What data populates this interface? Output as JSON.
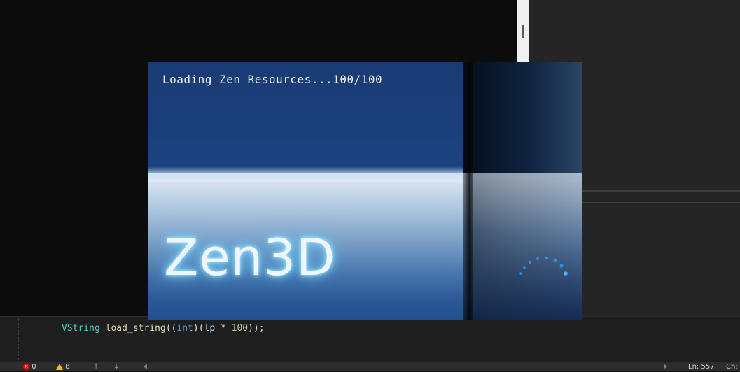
{
  "editor": {
    "code": {
      "type": "VString",
      "func": "load_string",
      "paren_open": "((",
      "keyword": "int",
      "mid": ")(",
      "var": "lp",
      "op": " * ",
      "num": "100",
      "tail": "));"
    }
  },
  "statusbar": {
    "errors": "0",
    "warnings": "8",
    "line": "Ln: 557",
    "char": "Ch:"
  },
  "splash": {
    "loading_text": "Loading Zen Resources...100/100",
    "progress": 1.0,
    "logo": "Zen3D"
  },
  "colors": {
    "splash_bg": "#1a3c78",
    "logo_glow": "#7fd8ff"
  }
}
